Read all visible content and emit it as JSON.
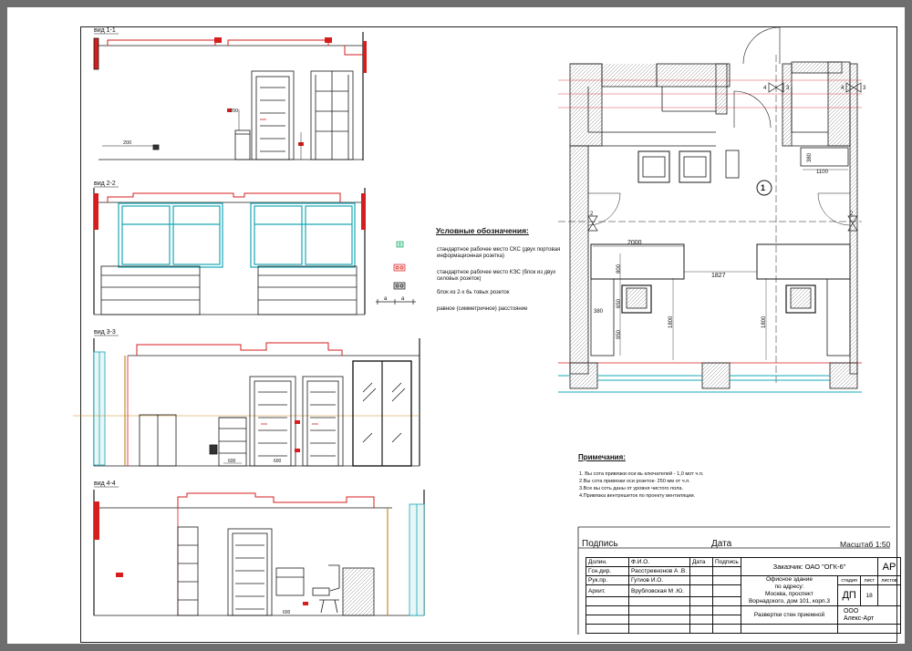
{
  "sections": {
    "s1": "вид 1-1",
    "s2": "вид 2-2",
    "s3": "вид 3-3",
    "s4": "вид 4-4"
  },
  "dims": {
    "d200a": "200",
    "d200b": "200",
    "d2000": "2000",
    "d1827": "1827",
    "d800": "800",
    "d650": "650",
    "d950": "950",
    "d380a": "380",
    "d1800a": "1800",
    "d1800b": "1800",
    "d1100": "1100",
    "d380b": "380",
    "d600a": "600",
    "d600b": "600",
    "d600c": "600",
    "axis1": "1",
    "m4a": "4",
    "m3a": "3",
    "m4b": "4",
    "m3b": "3",
    "m2a": "2",
    "m2b": "2"
  },
  "legend": {
    "title": "Условные обозначения:",
    "items": [
      {
        "text": "стандартное рабочее место СКС (двух портовая информационная розетка)",
        "color": "#1aa36a"
      },
      {
        "text": "стандартное рабочее место КЭС (блок из двух силовых розеток)",
        "color": "#d22020"
      },
      {
        "text": "блок из 2-х 6ь товых розеток",
        "color": "#333333"
      },
      {
        "text": "равное (симметричное) расстояние",
        "color": "#333333"
      }
    ],
    "sym_a": "a",
    "sym_b": "a"
  },
  "notes": {
    "title": "Примечания:",
    "items": [
      "1. Вы сота привязки оси вь ключателей - 1,0 мот ч.п.",
      "2.Вы сота привязки оси розеток- 250 мм от ч.п.",
      "3.Все вы соть  даны от уровня чистого пола.",
      "4.Привязка вентрешеток по проекту вентиляции."
    ]
  },
  "titleblock": {
    "podpis": "Подпись",
    "data": "Дата",
    "scale": "Масштаб 1:50",
    "rows": [
      {
        "role": "Долин.",
        "name": "Ф.И.О."
      },
      {
        "role": "Гсн.дир.",
        "name": "Расстрекнонов А .В."
      },
      {
        "role": "Рук.пр.",
        "name": "Гутиов И.О."
      },
      {
        "role": "Архит.",
        "name": "Врубловская М .Ю."
      }
    ],
    "col_date": "Дата",
    "col_sign": "Подпись",
    "customer": "Заказчик:   ОАО \"ОГК-6\"",
    "code": "АР",
    "building": "Офисное здание",
    "address": "по адресу:\nМосква, проспект\nВорнадского, дом 101, корп.3",
    "stage_h": "стадия",
    "sheet_h": "лист",
    "sheets_h": "листов",
    "stage": "ДП",
    "sheet": "18",
    "sheets": "",
    "drawing": "Развертки стен приемной",
    "org": "ООО\nАлекс-Арт"
  },
  "colors": {
    "line": "#1a1a1a",
    "red": "#d61e1e",
    "cyan": "#18a7b5",
    "orange": "#c98a2a",
    "gray": "#b9b9b9"
  }
}
